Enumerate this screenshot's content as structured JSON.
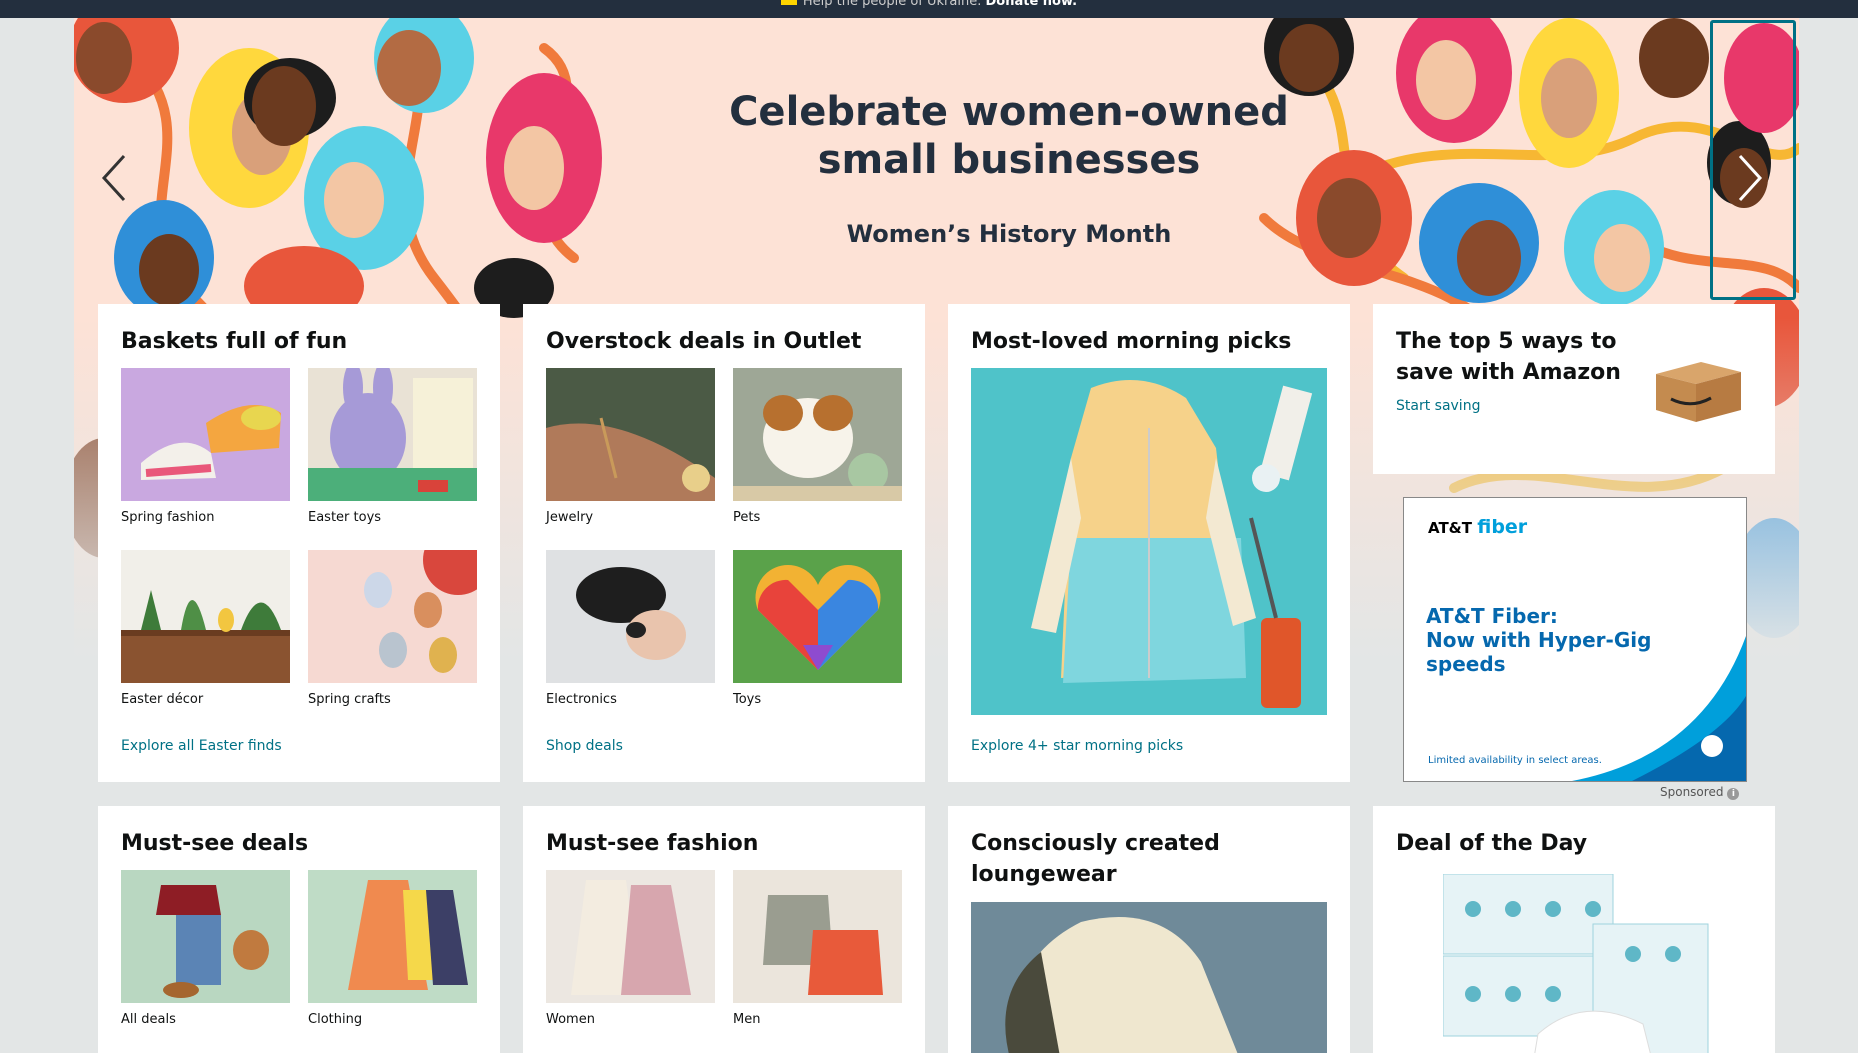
{
  "banner_strip": {
    "text": "Help the people of Ukraine.",
    "action": "Donate now."
  },
  "hero": {
    "title_line1": "Celebrate women-owned",
    "title_line2": "small businesses",
    "subtitle": "Women’s History Month"
  },
  "cards": [
    {
      "title": "Baskets full of fun",
      "items": [
        "Spring fashion",
        "Easter toys",
        "Easter décor",
        "Spring crafts"
      ],
      "link": "Explore all Easter finds"
    },
    {
      "title": "Overstock deals in Outlet",
      "items": [
        "Jewelry",
        "Pets",
        "Electronics",
        "Toys"
      ],
      "link": "Shop deals"
    },
    {
      "title": "Most-loved morning picks",
      "link": "Explore 4+ star morning picks"
    },
    {
      "title_line1": "The top 5 ways to",
      "title_line2": "save with Amazon",
      "link": "Start saving"
    }
  ],
  "ad": {
    "brand": "AT&T",
    "brand_product": "fiber",
    "headline_line1": "AT&T Fiber:",
    "headline_line2": "Now with Hyper-Gig speeds",
    "fine_print": "Limited availability in select areas.",
    "sponsored": "Sponsored"
  },
  "row2": [
    {
      "title": "Must-see deals",
      "items": [
        "All deals",
        "Clothing"
      ]
    },
    {
      "title": "Must-see fashion",
      "items": [
        "Women",
        "Men"
      ]
    },
    {
      "title_line1": "Consciously created",
      "title_line2": "loungewear"
    },
    {
      "title": "Deal of the Day"
    }
  ],
  "colors": {
    "link": "#007185",
    "hero_bg": "#fde2d6",
    "page_bg": "#e3e6e6",
    "nav_dark": "#232f3e"
  }
}
